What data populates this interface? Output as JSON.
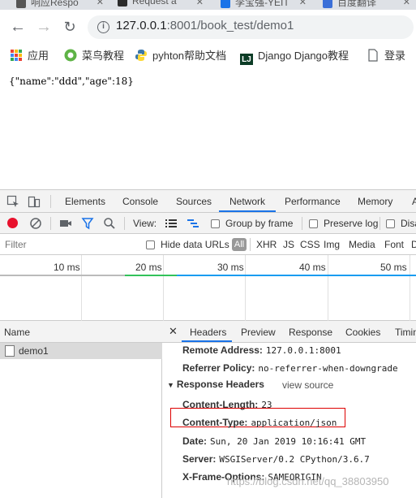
{
  "browser": {
    "tabs": [
      {
        "label": "响应Respo",
        "icon_color": "#555555"
      },
      {
        "label": "Request a",
        "icon_color": "#2b2b2b"
      },
      {
        "label": "李宝强-YEIT",
        "icon_color": "#1a73e8"
      },
      {
        "label": "百度翻译",
        "icon_color": "#3b6fd8"
      }
    ],
    "url_host": "127.0.0.1",
    "url_path": ":8001/book_test/demo1",
    "bookmarks": [
      {
        "label": "应用",
        "icon": "apps-grid-icon"
      },
      {
        "label": "菜鸟教程",
        "icon": "runoob-icon"
      },
      {
        "label": "pyhton帮助文档",
        "icon": "python-icon"
      },
      {
        "label": "Django Django教程",
        "icon": "django-icon"
      },
      {
        "label": "登录",
        "icon": "page-icon"
      }
    ]
  },
  "page": {
    "json_text": "{\"name\":\"ddd\",\"age\":18}"
  },
  "devtools": {
    "tabs": [
      "Elements",
      "Console",
      "Sources",
      "Network",
      "Performance",
      "Memory",
      "A"
    ],
    "active_tab": "Network",
    "toolbar": {
      "view_label": "View:",
      "group_by_frame": "Group by frame",
      "preserve_log": "Preserve log",
      "disable_cache": "Disa"
    },
    "filter": {
      "placeholder": "Filter",
      "hide_data_urls": "Hide data URLs",
      "all_label": "All",
      "types": [
        "XHR",
        "JS",
        "CSS",
        "Img",
        "Media",
        "Font",
        "D"
      ]
    },
    "timeline": {
      "ticks": [
        "10 ms",
        "20 ms",
        "30 ms",
        "40 ms",
        "50 ms"
      ]
    },
    "requests": {
      "header": "Name",
      "rows": [
        {
          "name": "demo1"
        }
      ]
    },
    "detail": {
      "tabs": [
        "Headers",
        "Preview",
        "Response",
        "Cookies",
        "Timin"
      ],
      "active_tab": "Headers",
      "general": [
        {
          "key": "Remote Address:",
          "value": "127.0.0.1:8001"
        },
        {
          "key": "Referrer Policy:",
          "value": "no-referrer-when-downgrade"
        }
      ],
      "response_headers_title": "Response Headers",
      "view_source": "view source",
      "response_headers": [
        {
          "key": "Content-Length:",
          "value": "23"
        },
        {
          "key": "Content-Type:",
          "value": "application/json"
        },
        {
          "key": "Date:",
          "value": "Sun, 20 Jan 2019 10:16:41 GMT"
        },
        {
          "key": "Server:",
          "value": "WSGIServer/0.2 CPython/3.6.7"
        },
        {
          "key": "X-Frame-Options:",
          "value": "SAMEORIGIN"
        }
      ]
    }
  },
  "watermark": "https://blog.csdn.net/qq_38803950",
  "colors": {
    "accent": "#1a73e8",
    "record_red": "#e8112d",
    "highlight_border": "#dd0000"
  }
}
